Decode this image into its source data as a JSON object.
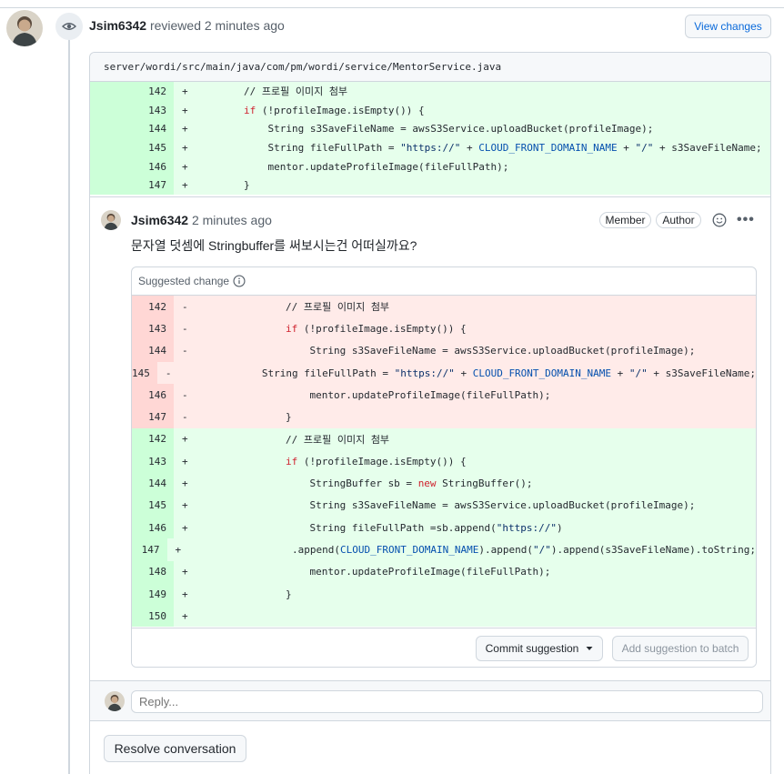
{
  "review": {
    "author": "Jsim6342",
    "action": "reviewed",
    "time": "2 minutes ago",
    "view_changes_label": "View changes"
  },
  "file": {
    "path": "server/wordi/src/main/java/com/pm/wordi/service/MentorService.java",
    "diff": [
      {
        "ln": "142",
        "sign": "+",
        "code": "        // 프로필 이미지 첨부"
      },
      {
        "ln": "143",
        "sign": "+",
        "code": "        if (!profileImage.isEmpty()) {"
      },
      {
        "ln": "144",
        "sign": "+",
        "code": "            String s3SaveFileName = awsS3Service.uploadBucket(profileImage);"
      },
      {
        "ln": "145",
        "sign": "+",
        "code": "            String fileFullPath = \"https://\" + CLOUD_FRONT_DOMAIN_NAME + \"/\" + s3SaveFileName;"
      },
      {
        "ln": "146",
        "sign": "+",
        "code": "            mentor.updateProfileImage(fileFullPath);"
      },
      {
        "ln": "147",
        "sign": "+",
        "code": "        }"
      }
    ]
  },
  "comment": {
    "author": "Jsim6342",
    "time": "2 minutes ago",
    "member_label": "Member",
    "author_label": "Author",
    "body": "문자열 덧셈에 Stringbuffer를 써보시는건 어떠실까요?",
    "suggested_change_label": "Suggested change",
    "removed": [
      {
        "ln": "142",
        "sign": "-",
        "code": "        // 프로필 이미지 첨부"
      },
      {
        "ln": "143",
        "sign": "-",
        "code": "        if (!profileImage.isEmpty()) {"
      },
      {
        "ln": "144",
        "sign": "-",
        "code": "            String s3SaveFileName = awsS3Service.uploadBucket(profileImage);"
      },
      {
        "ln": "145",
        "sign": "-",
        "code": "            String fileFullPath = \"https://\" + CLOUD_FRONT_DOMAIN_NAME + \"/\" + s3SaveFileName;"
      },
      {
        "ln": "146",
        "sign": "-",
        "code": "            mentor.updateProfileImage(fileFullPath);"
      },
      {
        "ln": "147",
        "sign": "-",
        "code": "        }"
      }
    ],
    "added": [
      {
        "ln": "142",
        "sign": "+",
        "code": "        // 프로필 이미지 첨부"
      },
      {
        "ln": "143",
        "sign": "+",
        "code": "        if (!profileImage.isEmpty()) {"
      },
      {
        "ln": "144",
        "sign": "+",
        "code": "            StringBuffer sb = new StringBuffer();"
      },
      {
        "ln": "145",
        "sign": "+",
        "code": "            String s3SaveFileName = awsS3Service.uploadBucket(profileImage);"
      },
      {
        "ln": "146",
        "sign": "+",
        "code": "            String fileFullPath =sb.append(\"https://\")"
      },
      {
        "ln": "147",
        "sign": "+",
        "code": "            .append(CLOUD_FRONT_DOMAIN_NAME).append(\"/\").append(s3SaveFileName).toString;"
      },
      {
        "ln": "148",
        "sign": "+",
        "code": "            mentor.updateProfileImage(fileFullPath);"
      },
      {
        "ln": "149",
        "sign": "+",
        "code": "        }"
      },
      {
        "ln": "150",
        "sign": "+",
        "code": ""
      }
    ],
    "commit_label": "Commit suggestion",
    "batch_label": "Add suggestion to batch"
  },
  "reply": {
    "placeholder": "Reply..."
  },
  "resolve_label": "Resolve conversation",
  "icons": {
    "eye": "eye-icon",
    "info": "info-icon",
    "smile": "smiley-icon",
    "kebab": "kebab-horizontal-icon",
    "caret": "triangle-down-icon"
  },
  "colors": {
    "addition_bg": "#e6ffec",
    "addition_num_bg": "#ccffd8",
    "deletion_bg": "#ffebe9",
    "deletion_num_bg": "#ffd7d5",
    "link": "#0969da"
  }
}
